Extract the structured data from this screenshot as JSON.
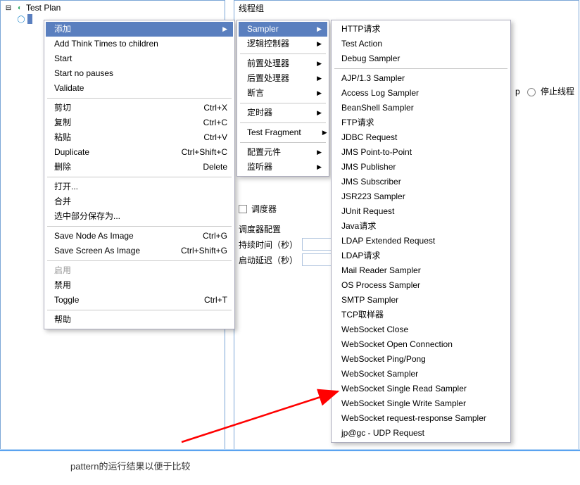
{
  "tree": {
    "root": "Test Plan"
  },
  "right_title": "线程组",
  "right_fields": {
    "scheduler_chk": "调度器",
    "scheduler_cfg": "调度器配置",
    "duration": "持续时间（秒）",
    "delay": "启动延迟（秒）",
    "loop_suffix": "p",
    "stop_thread": "停止线程"
  },
  "context_menu": [
    {
      "label": "添加",
      "submenu": true,
      "hl": true
    },
    {
      "label": "Add Think Times to children"
    },
    {
      "label": "Start"
    },
    {
      "label": "Start no pauses"
    },
    {
      "label": "Validate"
    },
    {
      "sep": true
    },
    {
      "label": "剪切",
      "shortcut": "Ctrl+X"
    },
    {
      "label": "复制",
      "shortcut": "Ctrl+C"
    },
    {
      "label": "粘贴",
      "shortcut": "Ctrl+V"
    },
    {
      "label": "Duplicate",
      "shortcut": "Ctrl+Shift+C"
    },
    {
      "label": "删除",
      "shortcut": "Delete"
    },
    {
      "sep": true
    },
    {
      "label": "打开..."
    },
    {
      "label": "合并"
    },
    {
      "label": "选中部分保存为..."
    },
    {
      "sep": true
    },
    {
      "label": "Save Node As Image",
      "shortcut": "Ctrl+G"
    },
    {
      "label": "Save Screen As Image",
      "shortcut": "Ctrl+Shift+G"
    },
    {
      "sep": true
    },
    {
      "label": "启用",
      "disabled": true
    },
    {
      "label": "禁用"
    },
    {
      "label": "Toggle",
      "shortcut": "Ctrl+T"
    },
    {
      "sep": true
    },
    {
      "label": "帮助"
    }
  ],
  "add_submenu": [
    {
      "label": "Sampler",
      "submenu": true,
      "hl": true
    },
    {
      "label": "逻辑控制器",
      "submenu": true
    },
    {
      "sep": true
    },
    {
      "label": "前置处理器",
      "submenu": true
    },
    {
      "label": "后置处理器",
      "submenu": true
    },
    {
      "label": "断言",
      "submenu": true
    },
    {
      "sep": true
    },
    {
      "label": "定时器",
      "submenu": true
    },
    {
      "sep": true
    },
    {
      "label": "Test Fragment",
      "submenu": true
    },
    {
      "sep": true
    },
    {
      "label": "配置元件",
      "submenu": true
    },
    {
      "label": "监听器",
      "submenu": true
    }
  ],
  "sampler_submenu": [
    "HTTP请求",
    "Test Action",
    "Debug Sampler",
    "",
    "AJP/1.3 Sampler",
    "Access Log Sampler",
    "BeanShell Sampler",
    "FTP请求",
    "JDBC Request",
    "JMS Point-to-Point",
    "JMS Publisher",
    "JMS Subscriber",
    "JSR223 Sampler",
    "JUnit Request",
    "Java请求",
    "LDAP Extended Request",
    "LDAP请求",
    "Mail Reader Sampler",
    "OS Process Sampler",
    "SMTP Sampler",
    "TCP取样器",
    "WebSocket Close",
    "WebSocket Open Connection",
    "WebSocket Ping/Pong",
    "WebSocket Sampler",
    "WebSocket Single Read Sampler",
    "WebSocket Single Write Sampler",
    "WebSocket request-response Sampler",
    "jp@gc - UDP Request"
  ],
  "bottom_text": "pattern的运行结果以便于比较"
}
